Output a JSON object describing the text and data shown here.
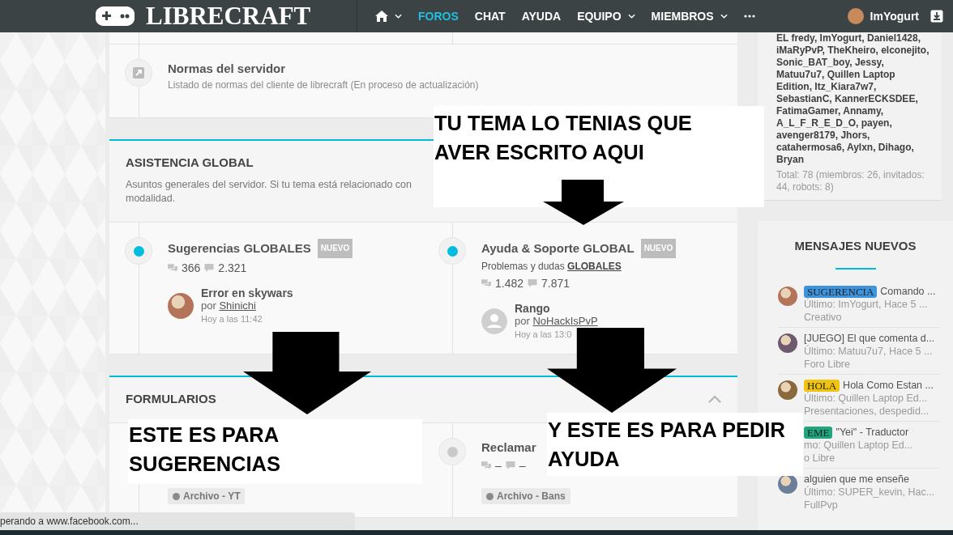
{
  "header": {
    "logo": "LIBRECRAFT",
    "nav": [
      {
        "kind": "home",
        "dropdown": true,
        "selected": false
      },
      {
        "kind": "text",
        "label": "FOROS",
        "dropdown": false,
        "selected": true
      },
      {
        "kind": "text",
        "label": "CHAT",
        "dropdown": false,
        "selected": false
      },
      {
        "kind": "text",
        "label": "AYUDA",
        "dropdown": false,
        "selected": false
      },
      {
        "kind": "text",
        "label": "EQUIPO",
        "dropdown": true,
        "selected": false
      },
      {
        "kind": "text",
        "label": "MIEMBROS",
        "dropdown": true,
        "selected": false
      },
      {
        "kind": "more",
        "dropdown": false,
        "selected": false
      }
    ],
    "user": {
      "name": "ImYogurt"
    }
  },
  "forum_list": {
    "sections": [
      {
        "kind": "plain",
        "nodes": [
          {
            "kind": "link",
            "title": "Normas del servidor",
            "description": "Listado de normas del cliente de librecraft (En proceso de actualización)"
          }
        ]
      },
      {
        "kind": "category",
        "title": "ASISTENCIA GLOBAL",
        "description_lines": [
          "Asuntos generales del servidor. Si tu tema está relacionado con",
          "modalidad."
        ],
        "collapse_toggle": false,
        "nodes": [
          {
            "kind": "forum",
            "unread": true,
            "title": "Sugerencias GLOBALES",
            "badge": "NUEVO",
            "stats": {
              "threads": "366",
              "messages": "2.321"
            },
            "last_post": {
              "default_avatar": false,
              "title": "Error en skywars",
              "by": "por",
              "user": "Shinichi",
              "time": "Hoy a las 11:42"
            }
          },
          {
            "kind": "forum",
            "unread": true,
            "title": "Ayuda & Soporte GLOBAL",
            "badge": "NUEVO",
            "description": "Problemas y dudas",
            "description_link": "GLOBALES",
            "stats": {
              "threads": "1.482",
              "messages": "7.871"
            },
            "last_post": {
              "default_avatar": true,
              "title": "Rango",
              "by": "por",
              "user": "NoHackIsPvP",
              "time": "Hoy a las 13:0"
            }
          }
        ]
      },
      {
        "kind": "category",
        "title": "FORMULARIOS",
        "collapse_toggle": true,
        "nodes": [
          {
            "kind": "forum",
            "prefix_tag": "Archivo - YT"
          },
          {
            "kind": "forum",
            "unread": false,
            "title": "Reclamar",
            "stats": {
              "threads": "–",
              "messages": "–"
            },
            "prefix_tag": "Archivo - Bans"
          }
        ]
      }
    ]
  },
  "sidebar": {
    "online": {
      "members": "EL fredy, ImYogurt, Daniel1428, iMaRyPvP, TheKheiro, elconejito, Sonic_BAT_boy, Jessy, Matuu7u7, Quillen Laptop Edition, Itz_Kiara7w7, SebastianC, KannerECKSDEE, FatimaGamer, Annamy, A_L_F_R_E_D_O, payen, avenger8179, Jhors, catahermosa6, Aylxn, Dihago, Bryan",
      "total": "Total: 78 (miembros: 26, invitados: 44, robots: 8)"
    },
    "new_posts": {
      "title": "MENSAJES NUEVOS",
      "items": [
        {
          "avatar": true,
          "tag": {
            "label": "SUGERENCIA",
            "color": "#3d93dc"
          },
          "title": "Comando ...",
          "meta": "Último: ImYogurt, Hace 5 ...",
          "forum": "Creativo"
        },
        {
          "avatar": true,
          "title": "[JUEGO] El que comenta d...",
          "meta": "Último: Matuu7u7, Hace 5 ...",
          "forum": "Foro Libre"
        },
        {
          "avatar": true,
          "tag": {
            "label": "HOLA",
            "color": "#f0c30f"
          },
          "title": "Hola Como Estan ...",
          "meta": "Último: Quillen Laptop Ed...",
          "forum": "Presentaciones, despedid..."
        },
        {
          "avatar": false,
          "tag": {
            "label": "EME",
            "color": "#1fa67f"
          },
          "title": "\"Yei\" - Traductor",
          "meta": "mo: Quillen Laptop Ed...",
          "forum": "o Libre"
        },
        {
          "avatar": true,
          "title": "alguien que me enseñe",
          "meta": "Último: SUPER_kevin, Hac...",
          "forum": "FullPvp"
        }
      ]
    }
  },
  "annotations": [
    {
      "lines": [
        "TU TEMA LO TENIAS QUE",
        "AVER ESCRITO AQUI"
      ]
    },
    {
      "lines": [
        "ESTE ES PARA",
        "SUGERENCIAS"
      ]
    },
    {
      "lines": [
        "Y ESTE ES PARA PEDIR",
        "AYUDA"
      ]
    }
  ],
  "browser_status": "perando a www.facebook.com..."
}
